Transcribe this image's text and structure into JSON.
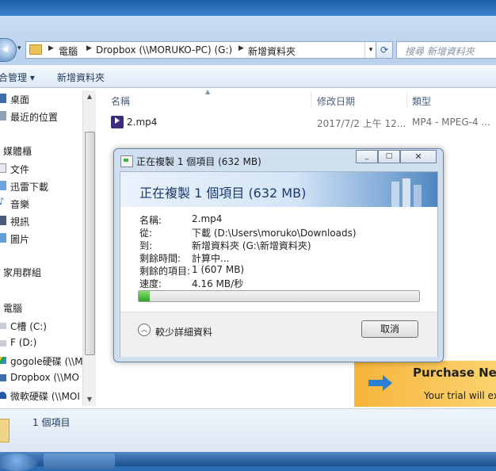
{
  "address_bar": {
    "crumbs": [
      "電腦",
      "Dropbox (\\\\MORUKO-PC) (G:)",
      "新增資料夾"
    ]
  },
  "search": {
    "placeholder": "搜尋 新增資料夾"
  },
  "toolbar": {
    "organize": "組合管理 ▾",
    "new_folder": "新增資料夾"
  },
  "sidebar": {
    "favorites": [
      "桌面",
      "最近的位置"
    ],
    "libraries_title": "媒體櫃",
    "libraries": [
      "文件",
      "迅雷下載",
      "音樂",
      "視訊",
      "圖片"
    ],
    "homegroup": "家用群組",
    "computer_title": "電腦",
    "drives": [
      "C槽 (C:)",
      "F (D:)",
      "gogole硬碟 (\\\\MO",
      "Dropbox (\\\\MO",
      "微軟硬碟 (\\\\MOI"
    ]
  },
  "columns": {
    "name": "名稱",
    "date": "修改日期",
    "type": "類型"
  },
  "files": [
    {
      "name": "2.mp4",
      "date": "2017/7/2 上午 12...",
      "type": "MP4 - MPEG-4 ..."
    }
  ],
  "status": {
    "count": "1 個項目"
  },
  "ad": {
    "title": "Purchase Neth",
    "text": "Your trial will exp"
  },
  "dialog": {
    "title": "正在複製 1 個項目 (632 MB)",
    "heading": "正在複製 1 個項目 (632 MB)",
    "labels": {
      "name": "名稱:",
      "from": "從:",
      "to": "到:",
      "time_left": "剩餘時間:",
      "items_left": "剩餘的項目:",
      "speed": "速度:"
    },
    "values": {
      "name": "2.mp4",
      "from": "下載 (D:\\Users\\moruko\\Downloads)",
      "to": "新增資料夾 (G:\\新增資料夾)",
      "time_left": "計算中...",
      "items_left": "1 (607 MB)",
      "speed": "4.16 MB/秒"
    },
    "progress": 0.04,
    "less_details": "較少詳細資料",
    "cancel": "取消"
  }
}
